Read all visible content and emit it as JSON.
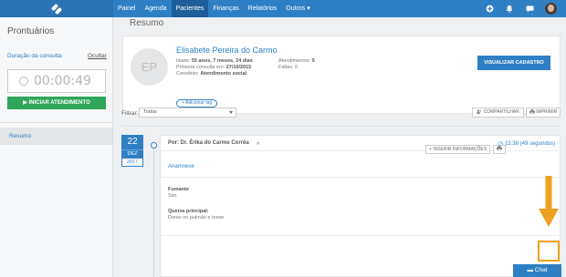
{
  "topbar": {
    "logo_icon": "app-logo-icon",
    "nav": [
      {
        "label": "Painel",
        "active": false
      },
      {
        "label": "Agenda",
        "active": false
      },
      {
        "label": "Pacientes",
        "active": true
      },
      {
        "label": "Finanças",
        "active": false
      },
      {
        "label": "Relatórios",
        "active": false
      },
      {
        "label": "Outros ▾",
        "active": false
      }
    ],
    "right_icons": [
      "add-icon",
      "bell-icon",
      "message-icon"
    ],
    "accent": "#2f7fc4"
  },
  "sidebar": {
    "title": "Prontuários",
    "duration_label": "Duração da consulta",
    "hide_label": "Ocultar",
    "timer_value": "00:00:49",
    "start_button": "▶ INICIAR ATENDIMENTO",
    "items": [
      {
        "label": "Resumo",
        "active": true
      }
    ],
    "start_color": "#2fa65a"
  },
  "main": {
    "title": "Resumo",
    "patient": {
      "initials": "EP",
      "name": "Elisabete Pereira do Carmo",
      "age_label": "Idade:",
      "age": "55 anos, 7 meses, 24 dias",
      "first_label": "Primeira consulta em:",
      "first_date": "27/10/2015",
      "insurance_label": "Convênio:",
      "insurance": "Atendimento social",
      "visits_label": "Atendimentos:",
      "visits": "5",
      "absences_label": "Faltas:",
      "absences": "0",
      "tag_button": "+ Adicionar tag",
      "view_button": "VISUALIZAR CADASTRO"
    },
    "filter": {
      "label": "Filtrar:",
      "selected": "Todos"
    },
    "share_button": "COMPARTILHAR",
    "print_button": "IMPRIMIR",
    "entry": {
      "day": "22",
      "month": "DEZ",
      "year": "2017",
      "author": "Por: Dr. Érika do Carmo Corrêa",
      "time": "15:38 (49 segundos)",
      "section": "Anamnese",
      "fields": [
        {
          "label": "Fumante",
          "value": "Sim"
        },
        {
          "label": "Queixa principal:",
          "value": "Dores no pulmão e tosse."
        }
      ],
      "insert_button": "+ INSERIR INFORMAÇÕES",
      "print_icon": "printer-icon"
    },
    "highlight_color": "#f0a020"
  },
  "chat": {
    "label": "Chat"
  }
}
